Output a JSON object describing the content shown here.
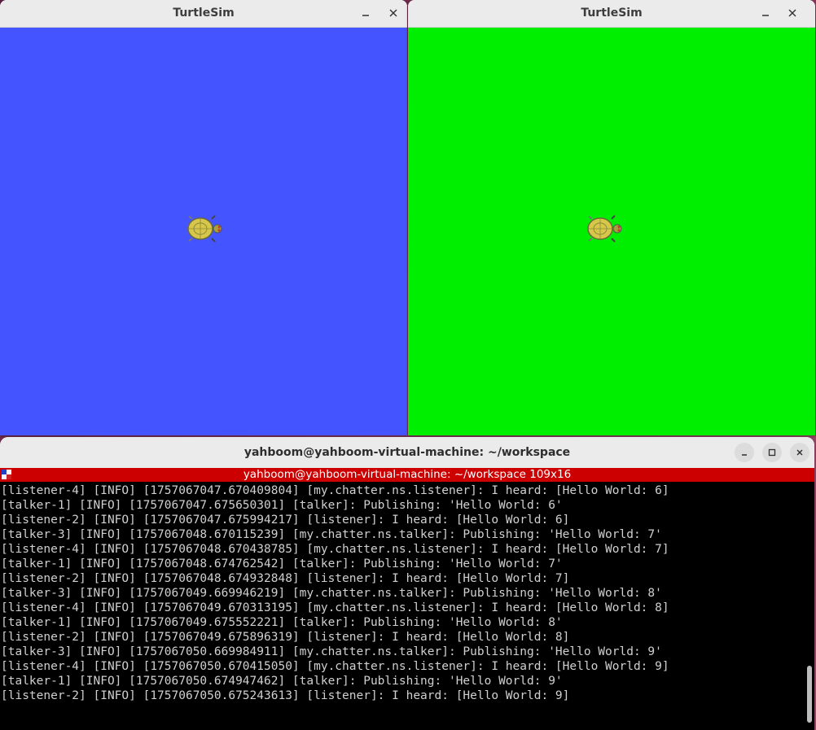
{
  "desktop": {
    "background": "#7a2a4d"
  },
  "turtlesim_left": {
    "title": "TurtleSim",
    "background_color": "#4455ff",
    "minimize_icon": "minimize-icon",
    "close_icon": "close-icon"
  },
  "turtlesim_right": {
    "title": "TurtleSim",
    "background_color": "#00ee00",
    "minimize_icon": "minimize-icon",
    "close_icon": "close-icon"
  },
  "terminal": {
    "title": "yahboom@yahboom-virtual-machine: ~/workspace",
    "tmux_status": "yahboom@yahboom-virtual-machine: ~/workspace 109x16",
    "tmux_color": "#cc0000",
    "lines": [
      "[listener-4] [INFO] [1757067047.670409804] [my.chatter.ns.listener]: I heard: [Hello World: 6]",
      "[talker-1] [INFO] [1757067047.675650301] [talker]: Publishing: 'Hello World: 6'",
      "[listener-2] [INFO] [1757067047.675994217] [listener]: I heard: [Hello World: 6]",
      "[talker-3] [INFO] [1757067048.670115239] [my.chatter.ns.talker]: Publishing: 'Hello World: 7'",
      "[listener-4] [INFO] [1757067048.670438785] [my.chatter.ns.listener]: I heard: [Hello World: 7]",
      "[talker-1] [INFO] [1757067048.674762542] [talker]: Publishing: 'Hello World: 7'",
      "[listener-2] [INFO] [1757067048.674932848] [listener]: I heard: [Hello World: 7]",
      "[talker-3] [INFO] [1757067049.669946219] [my.chatter.ns.talker]: Publishing: 'Hello World: 8'",
      "[listener-4] [INFO] [1757067049.670313195] [my.chatter.ns.listener]: I heard: [Hello World: 8]",
      "[talker-1] [INFO] [1757067049.675552221] [talker]: Publishing: 'Hello World: 8'",
      "[listener-2] [INFO] [1757067049.675896319] [listener]: I heard: [Hello World: 8]",
      "[talker-3] [INFO] [1757067050.669984911] [my.chatter.ns.talker]: Publishing: 'Hello World: 9'",
      "[listener-4] [INFO] [1757067050.670415050] [my.chatter.ns.listener]: I heard: [Hello World: 9]",
      "[talker-1] [INFO] [1757067050.674947462] [talker]: Publishing: 'Hello World: 9'",
      "[listener-2] [INFO] [1757067050.675243613] [listener]: I heard: [Hello World: 9]"
    ]
  }
}
